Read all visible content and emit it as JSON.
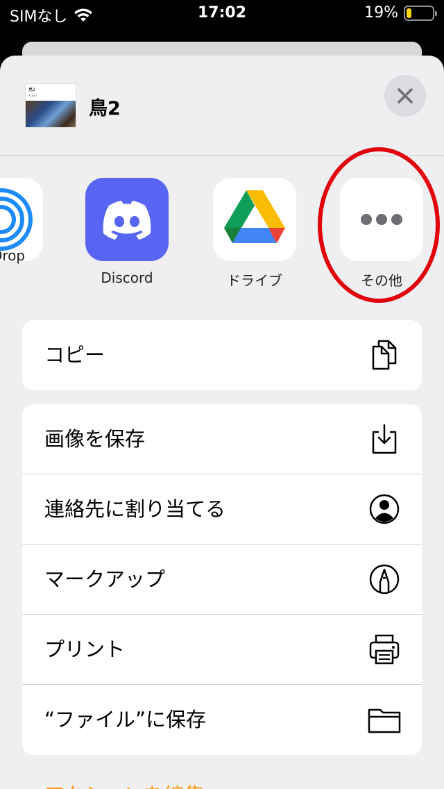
{
  "status": {
    "carrier": "SIMなし",
    "time": "17:02",
    "battery_percent": "19%",
    "battery_level": 0.19
  },
  "share": {
    "title": "鳥2",
    "thumb_title": "鳥2",
    "thumb_sub": "Xcjsy!"
  },
  "apps": [
    {
      "label": "Drop"
    },
    {
      "label": "Discord"
    },
    {
      "label": "ドライブ"
    },
    {
      "label": "その他"
    }
  ],
  "actions_group1": [
    {
      "label": "コピー",
      "icon": "copy-icon"
    }
  ],
  "actions_group2": [
    {
      "label": "画像を保存",
      "icon": "save-image-icon"
    },
    {
      "label": "連絡先に割り当てる",
      "icon": "contact-icon"
    },
    {
      "label": "マークアップ",
      "icon": "markup-icon"
    },
    {
      "label": "プリント",
      "icon": "printer-icon"
    },
    {
      "label": "“ファイル”に保存",
      "icon": "folder-icon"
    }
  ],
  "edit_actions_label": "アクションを編集...",
  "colors": {
    "discord": "#5865F2",
    "highlight": "#e1000a",
    "accent": "#ff9500",
    "airdrop": "#1d8cf8"
  }
}
